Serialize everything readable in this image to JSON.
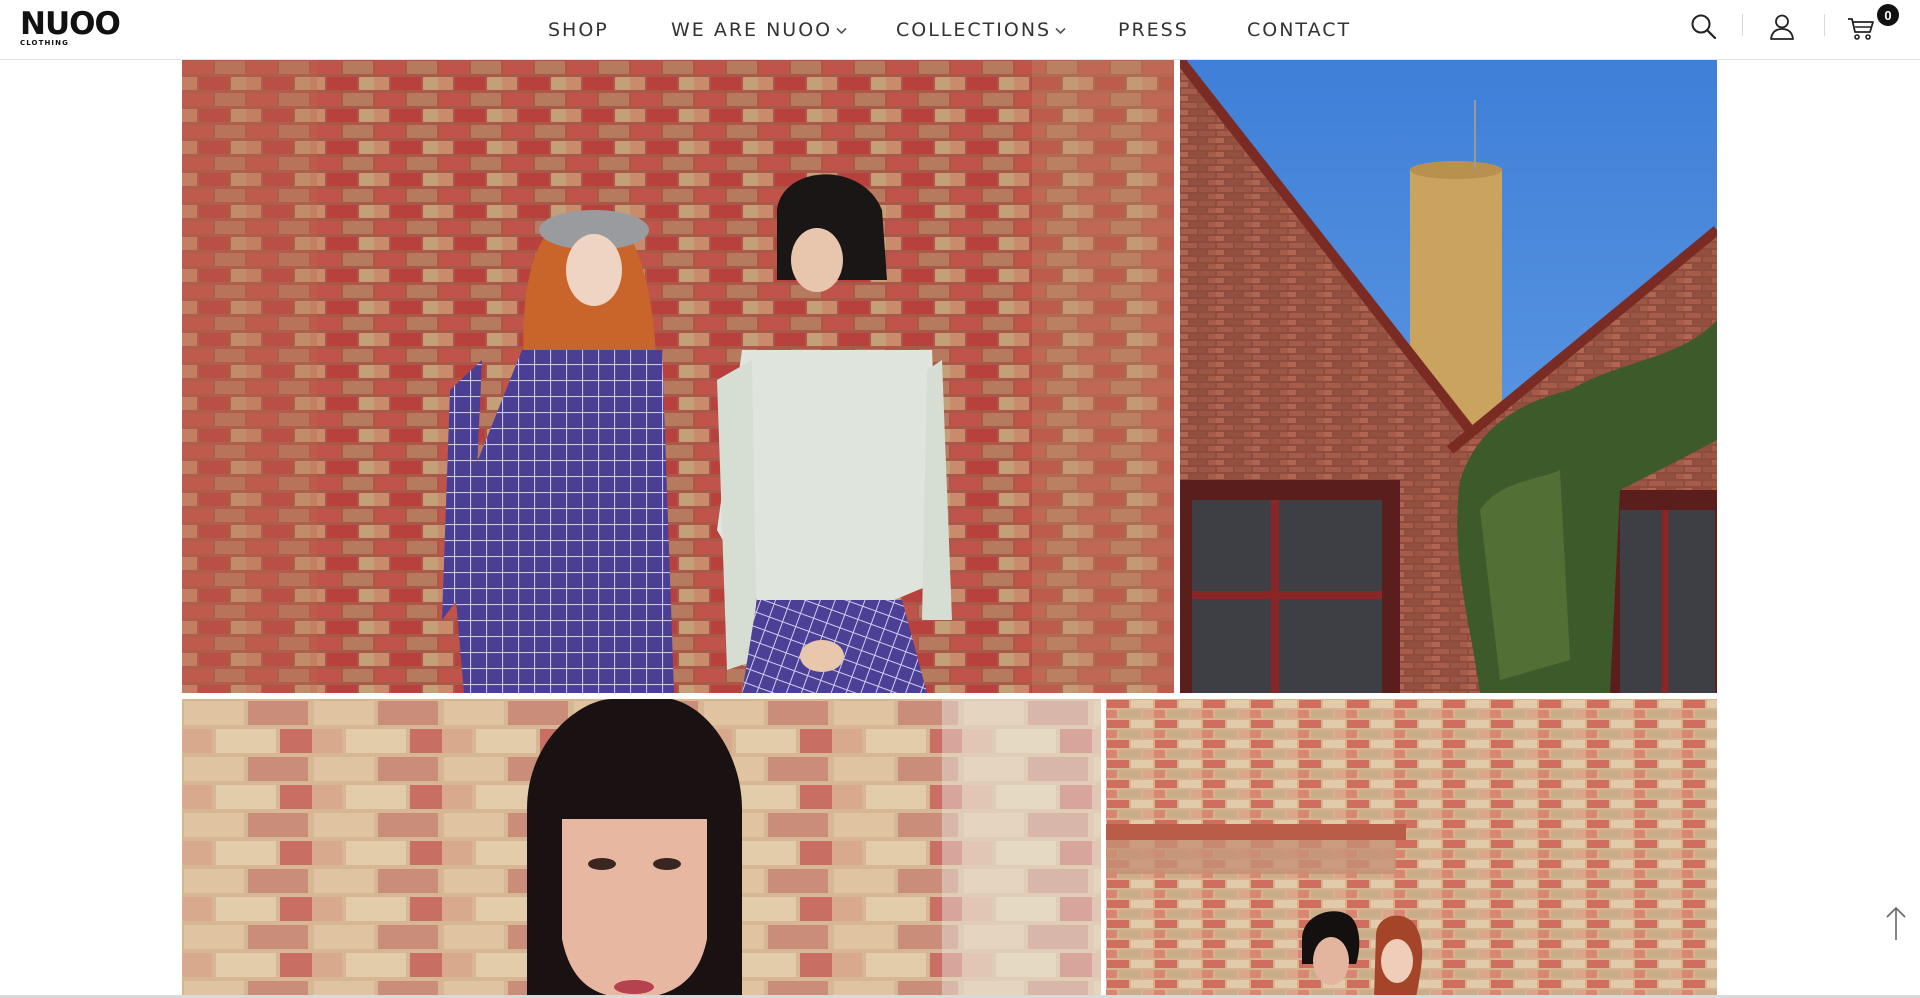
{
  "brand": {
    "name": "NUOO",
    "tagline": "CLOTHING"
  },
  "nav": {
    "items": [
      {
        "label": "SHOP",
        "has_dropdown": false
      },
      {
        "label": "WE ARE NUOO",
        "has_dropdown": true
      },
      {
        "label": "COLLECTIONS",
        "has_dropdown": true
      },
      {
        "label": "PRESS",
        "has_dropdown": false
      },
      {
        "label": "CONTACT",
        "has_dropdown": false
      }
    ],
    "dropdown_glyph": "⌄"
  },
  "header_icons": {
    "search": "search-icon",
    "account": "user-icon",
    "cart": "cart-icon"
  },
  "cart": {
    "count": "0"
  },
  "gallery": [
    {
      "subject": "two models in purple check outfits against red brick wall",
      "icon": "photo"
    },
    {
      "subject": "brick building with chimney and blue sky",
      "icon": "photo"
    },
    {
      "subject": "close-up of model with black bob haircut",
      "icon": "photo"
    },
    {
      "subject": "two models in front of brick wall",
      "icon": "photo"
    }
  ],
  "scroll_top": {
    "icon": "arrow-up-icon"
  },
  "colors": {
    "nav_text": "#333333",
    "badge_bg": "#111111",
    "divider": "#e2e2e2"
  }
}
